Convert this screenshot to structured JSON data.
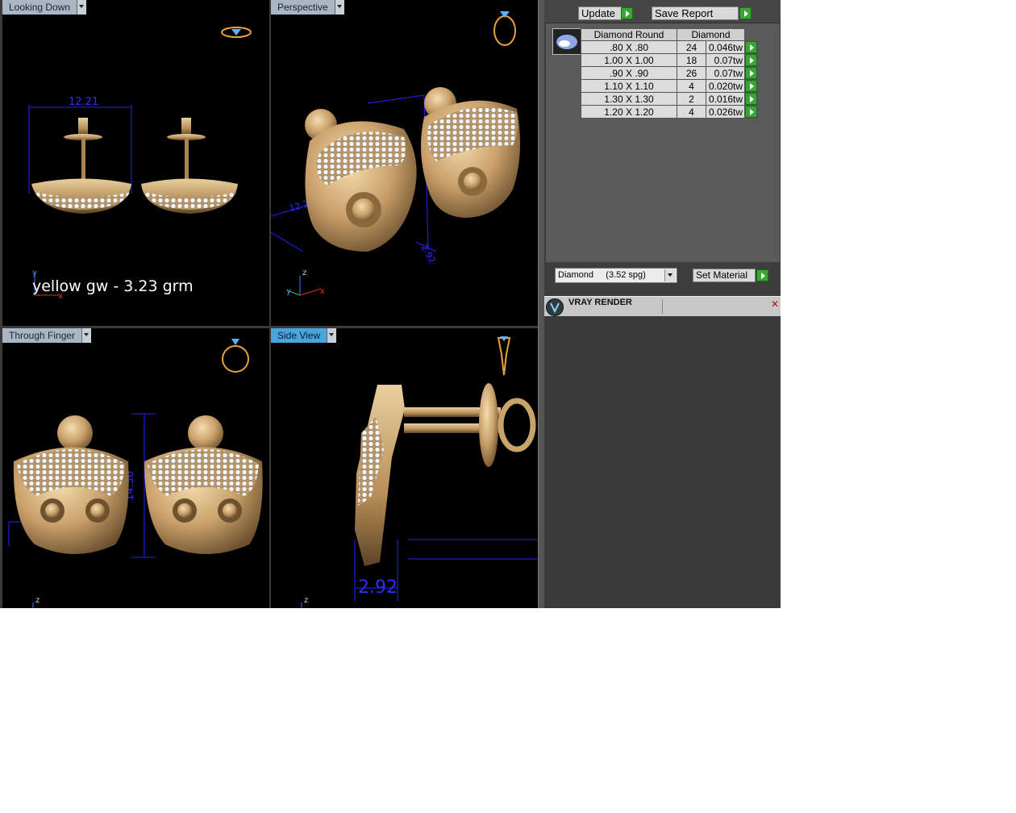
{
  "viewports": {
    "top_left": {
      "label": "Looking Down",
      "dimension": "12.21",
      "axis_y": "y",
      "axis_x": "x",
      "note": "yellow gw - 3.23 grm"
    },
    "top_right": {
      "label": "Perspective",
      "dimension_a": "12.21",
      "dimension_b": "2.92",
      "axis_z": "z",
      "axis_y": "y",
      "axis_x": "x"
    },
    "bottom_left": {
      "label": "Through Finger",
      "dimension": "14.36",
      "axis_z": "z"
    },
    "bottom_right": {
      "label": "Side View",
      "dimension": "2.92",
      "axis_z": "z"
    }
  },
  "report_toolbar": {
    "update_label": "Update",
    "save_report_label": "Save Report"
  },
  "diamond_table": {
    "headers": [
      "Diamond Round",
      "Diamond"
    ],
    "rows": [
      {
        "size": ".80 X .80",
        "count": "24",
        "weight": "0.046tw"
      },
      {
        "size": "1.00 X 1.00",
        "count": "18",
        "weight": "0.07tw"
      },
      {
        "size": ".90 X .90",
        "count": "26",
        "weight": "0.07tw"
      },
      {
        "size": "1.10 X 1.10",
        "count": "4",
        "weight": "0.020tw"
      },
      {
        "size": "1.30 X 1.30",
        "count": "2",
        "weight": "0.016tw"
      },
      {
        "size": "1.20 X 1.20",
        "count": "4",
        "weight": "0.026tw"
      }
    ]
  },
  "material": {
    "selected": "Diamond     (3.52 spg)",
    "set_label": "Set Material"
  },
  "vray": {
    "title": "VRAY RENDER"
  },
  "colors": {
    "gold": "#c9a46a",
    "dim_blue": "#1a1aff",
    "label_blue": "#4aa4de",
    "ok_green": "#3aa535"
  }
}
